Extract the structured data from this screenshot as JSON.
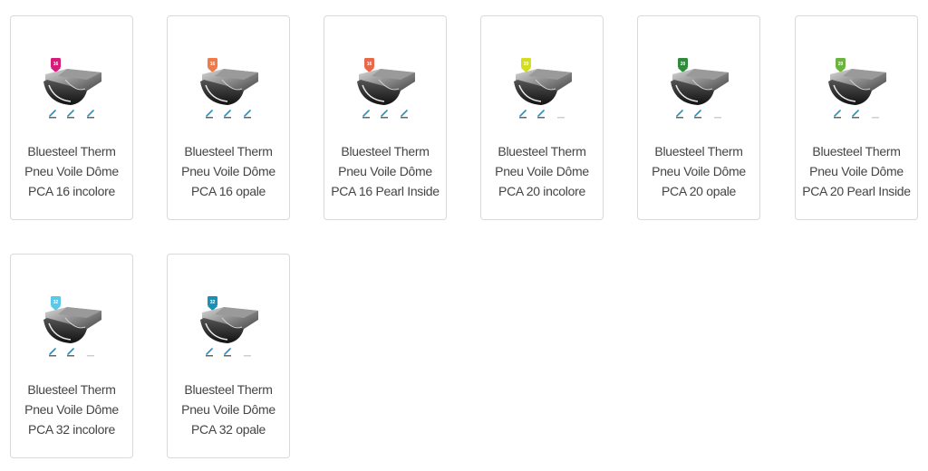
{
  "products": [
    {
      "line1": "Bluesteel Therm",
      "line2": "Pneu Voile Dôme",
      "line3": "PCA 16 incolore",
      "badge_color": "#d81b7b",
      "badge_label": "16",
      "ratings": [
        "active",
        "active",
        "active"
      ]
    },
    {
      "line1": "Bluesteel Therm",
      "line2": "Pneu Voile Dôme",
      "line3": "PCA 16 opale",
      "badge_color": "#f07a4a",
      "badge_label": "16",
      "ratings": [
        "active",
        "active",
        "active"
      ]
    },
    {
      "line1": "Bluesteel Therm",
      "line2": "Pneu Voile Dôme",
      "line3": "PCA 16 Pearl Inside",
      "badge_color": "#e8684a",
      "badge_label": "16",
      "ratings": [
        "active",
        "active",
        "active"
      ]
    },
    {
      "line1": "Bluesteel Therm",
      "line2": "Pneu Voile Dôme",
      "line3": "PCA 20 incolore",
      "badge_color": "#d4de1c",
      "badge_label": "20",
      "ratings": [
        "active",
        "active",
        "inactive"
      ]
    },
    {
      "line1": "Bluesteel Therm",
      "line2": "Pneu Voile Dôme",
      "line3": "PCA 20 opale",
      "badge_color": "#2e8b3a",
      "badge_label": "20",
      "ratings": [
        "active",
        "active",
        "inactive"
      ]
    },
    {
      "line1": "Bluesteel Therm",
      "line2": "Pneu Voile Dôme",
      "line3": "PCA 20 Pearl Inside",
      "badge_color": "#6cb33f",
      "badge_label": "20",
      "ratings": [
        "active",
        "active",
        "inactive"
      ]
    },
    {
      "line1": "Bluesteel Therm",
      "line2": "Pneu Voile Dôme",
      "line3": "PCA 32 incolore",
      "badge_color": "#5bc8e8",
      "badge_label": "32",
      "ratings": [
        "active",
        "active",
        "inactive"
      ]
    },
    {
      "line1": "Bluesteel Therm",
      "line2": "Pneu Voile Dôme",
      "line3": "PCA 32 opale",
      "badge_color": "#1c8fb5",
      "badge_label": "32",
      "ratings": [
        "active",
        "active",
        "inactive"
      ]
    }
  ],
  "rating_colors": {
    "active": "#2a8fbd",
    "inactive": "#cfcfcf"
  }
}
